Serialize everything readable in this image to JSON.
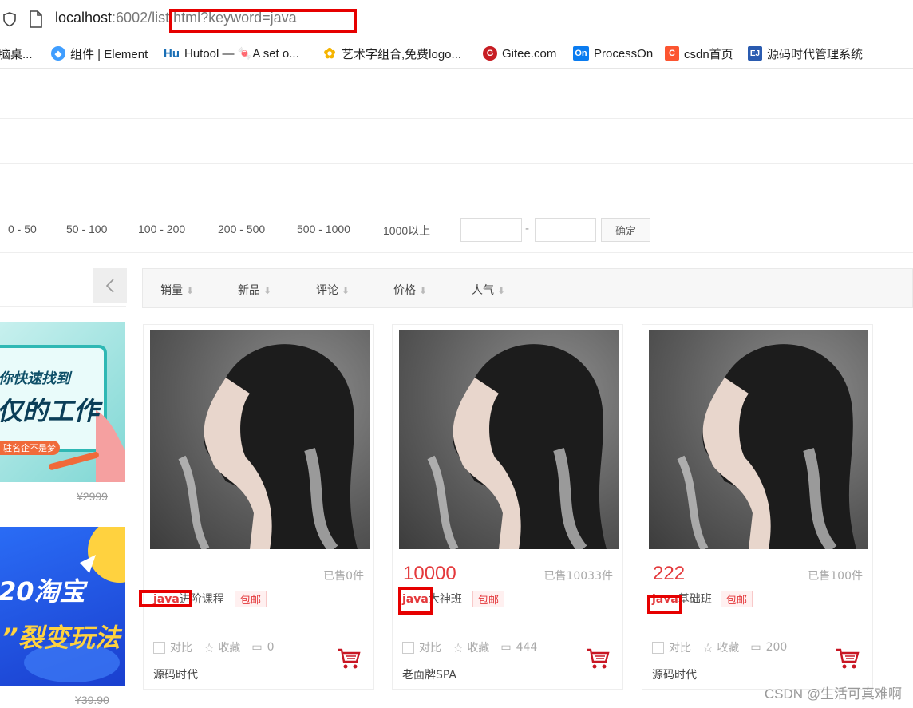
{
  "browser": {
    "url_host": "localhost",
    "url_path": ":6002/list.html?keyword=java",
    "bookmarks": [
      {
        "label": "脑桌...",
        "icon": "page-icon",
        "color": "#888"
      },
      {
        "label": "组件 | Element",
        "icon": "element-logo-icon",
        "color": "#409eff"
      },
      {
        "label": "Hutool — 🍬A set o...",
        "icon": "hutool-logo-icon",
        "color": "#1a6fb5"
      },
      {
        "label": "艺术字组合,免费logo...",
        "icon": "gear-logo-icon",
        "color": "#f5b400"
      },
      {
        "label": "Gitee.com",
        "icon": "gitee-logo-icon",
        "color": "#c71d23"
      },
      {
        "label": "ProcessOn",
        "icon": "processon-logo-icon",
        "color": "#0a7cf0"
      },
      {
        "label": "csdn首页",
        "icon": "csdn-logo-icon",
        "color": "#fc5531"
      },
      {
        "label": "源码时代管理系统",
        "icon": "ej-logo-icon",
        "color": "#2a5bb0"
      }
    ]
  },
  "price_filter": {
    "ranges": [
      "0 - 50",
      "50 - 100",
      "100 - 200",
      "200 - 500",
      "500 - 1000",
      "1000以上"
    ],
    "dash": "-",
    "confirm_label": "确定"
  },
  "sort_bar": {
    "items": [
      "销量",
      "新品",
      "评论",
      "价格",
      "人气"
    ],
    "arrow": "⬇"
  },
  "ads": {
    "ad1_lines": [
      "你快速找到",
      "仅的工作",
      "驻名企不是梦"
    ],
    "ad1_price": "¥2999",
    "ad2_lines": [
      "20淘宝",
      "”裂变玩法"
    ],
    "ad2_price": "¥39.90"
  },
  "products": [
    {
      "price": "",
      "sold": "已售0件",
      "keyword": "java",
      "title_rest": "进阶课程",
      "tag": "包邮",
      "compare": "对比",
      "favorite": "收藏",
      "comments": "0",
      "shop": "源码时代"
    },
    {
      "price": "10000",
      "sold": "已售10033件",
      "keyword": "java",
      "title_rest": "大神班",
      "tag": "包邮",
      "compare": "对比",
      "favorite": "收藏",
      "comments": "444",
      "shop": "老面牌SPA"
    },
    {
      "price": "222",
      "sold": "已售100件",
      "keyword": "java",
      "title_rest": "基础班",
      "tag": "包邮",
      "compare": "对比",
      "favorite": "收藏",
      "comments": "200",
      "shop": "源码时代"
    }
  ],
  "watermark": "CSDN @生活可真难啊",
  "colors": {
    "highlight": "#e60000",
    "price": "#e4393c",
    "cart": "#c81623"
  }
}
